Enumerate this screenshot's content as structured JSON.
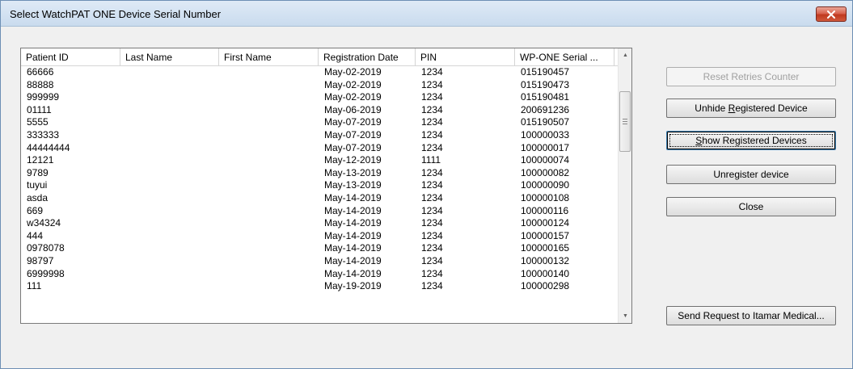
{
  "window": {
    "title": "Select WatchPAT ONE Device Serial Number"
  },
  "table": {
    "columns": [
      "Patient ID",
      "Last Name",
      "First Name",
      "Registration Date",
      "PIN",
      "WP-ONE Serial ..."
    ],
    "rows": [
      [
        "66666",
        "",
        "",
        "May-02-2019",
        "1234",
        "015190457"
      ],
      [
        "88888",
        "",
        "",
        "May-02-2019",
        "1234",
        "015190473"
      ],
      [
        "999999",
        "",
        "",
        "May-02-2019",
        "1234",
        "015190481"
      ],
      [
        "01111",
        "",
        "",
        "May-06-2019",
        "1234",
        "200691236"
      ],
      [
        "5555",
        "",
        "",
        "May-07-2019",
        "1234",
        "015190507"
      ],
      [
        "333333",
        "",
        "",
        "May-07-2019",
        "1234",
        "100000033"
      ],
      [
        "44444444",
        "",
        "",
        "May-07-2019",
        "1234",
        "100000017"
      ],
      [
        "12121",
        "",
        "",
        "May-12-2019",
        "1111",
        "100000074"
      ],
      [
        "9789",
        "",
        "",
        "May-13-2019",
        "1234",
        "100000082"
      ],
      [
        "tuyui",
        "",
        "",
        "May-13-2019",
        "1234",
        "100000090"
      ],
      [
        "asda",
        "",
        "",
        "May-14-2019",
        "1234",
        "100000108"
      ],
      [
        "669",
        "",
        "",
        "May-14-2019",
        "1234",
        "100000116"
      ],
      [
        "w34324",
        "",
        "",
        "May-14-2019",
        "1234",
        "100000124"
      ],
      [
        "444",
        "",
        "",
        "May-14-2019",
        "1234",
        "100000157"
      ],
      [
        "0978078",
        "",
        "",
        "May-14-2019",
        "1234",
        "100000165"
      ],
      [
        "98797",
        "",
        "",
        "May-14-2019",
        "1234",
        "100000132"
      ],
      [
        "6999998",
        "",
        "",
        "May-14-2019",
        "1234",
        "100000140"
      ],
      [
        "111",
        "",
        "",
        "May-19-2019",
        "1234",
        "100000298"
      ]
    ]
  },
  "buttons": {
    "reset_retries": "Reset Retries Counter",
    "unhide_prefix": "Unhide ",
    "unhide_accel": "R",
    "unhide_suffix": "egistered Device",
    "show_accel": "S",
    "show_suffix": "how Registered Devices",
    "unregister": "Unregister device",
    "close": "Close",
    "send_request": "Send Request to Itamar Medical..."
  },
  "icons": {
    "close": "close-icon",
    "scroll_up": "scroll-up-arrow-icon",
    "scroll_down": "scroll-down-arrow-icon",
    "scroll_grip": "scroll-grip-icon"
  },
  "colors": {
    "close_button": "#c0391f",
    "titlebar": "#c9dbee",
    "dialog_background": "#f0f0f0",
    "focus_border": "#3c7fb1"
  }
}
